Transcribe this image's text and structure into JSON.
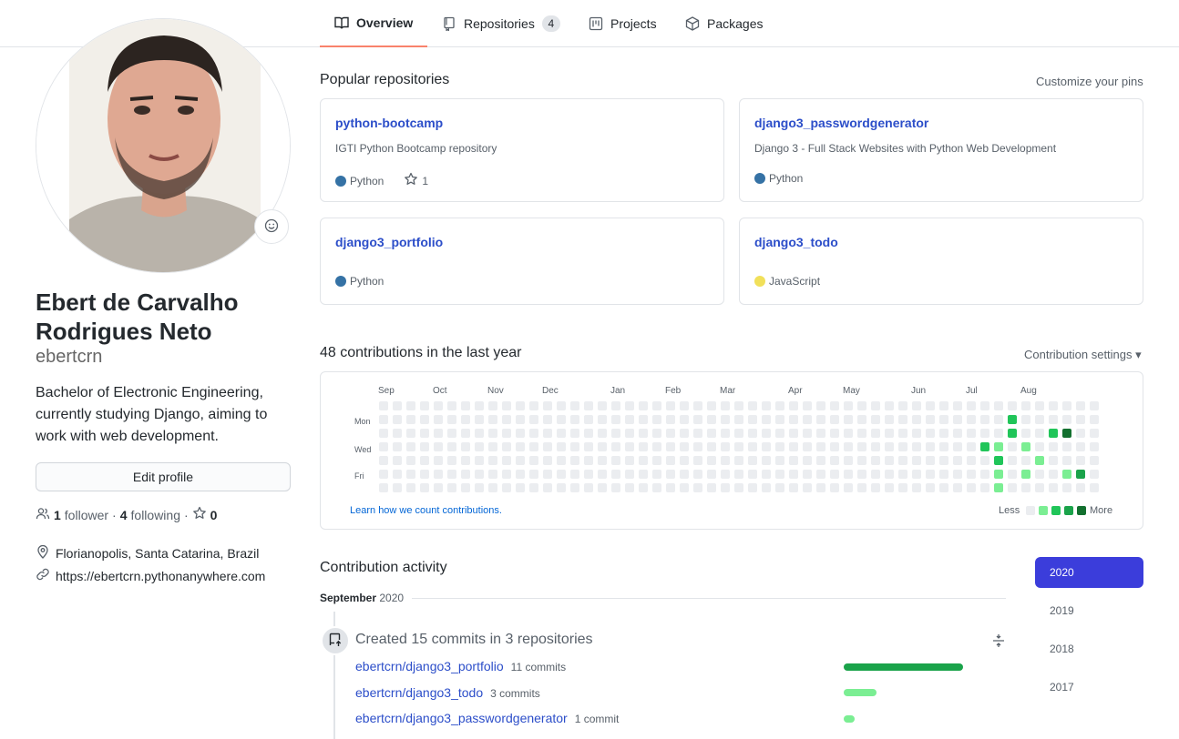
{
  "tabs": [
    {
      "label": "Overview",
      "icon": "book-icon",
      "active": true
    },
    {
      "label": "Repositories",
      "icon": "repo-icon",
      "count": "4"
    },
    {
      "label": "Projects",
      "icon": "project-icon"
    },
    {
      "label": "Packages",
      "icon": "package-icon"
    }
  ],
  "profile": {
    "fullname": "Ebert de Carvalho Rodrigues Neto",
    "username": "ebertcrn",
    "bio": "Bachelor of Electronic Engineering, currently studying Django, aiming to work with web development.",
    "edit_label": "Edit profile",
    "followers_count": "1",
    "followers_label": "follower",
    "following_count": "4",
    "following_label": "following",
    "stars_count": "0",
    "location": "Florianopolis, Santa Catarina, Brazil",
    "website": "https://ebertcrn.pythonanywhere.com"
  },
  "popular": {
    "title": "Popular repositories",
    "customize": "Customize your pins",
    "repos": [
      {
        "name": "python-bootcamp",
        "desc": "IGTI Python Bootcamp repository",
        "lang": "Python",
        "lang_color": "#3572A5",
        "stars": "1"
      },
      {
        "name": "django3_passwordgenerator",
        "desc": "Django 3 - Full Stack Websites with Python Web Development",
        "lang": "Python",
        "lang_color": "#3572A5"
      },
      {
        "name": "django3_portfolio",
        "desc": "",
        "lang": "Python",
        "lang_color": "#3572A5"
      },
      {
        "name": "django3_todo",
        "desc": "",
        "lang": "JavaScript",
        "lang_color": "#f1e05a"
      }
    ]
  },
  "contributions": {
    "title": "48 contributions in the last year",
    "settings": "Contribution settings",
    "months": [
      "Sep",
      "Oct",
      "Nov",
      "Dec",
      "Jan",
      "Feb",
      "Mar",
      "Apr",
      "May",
      "Jun",
      "Jul",
      "Aug"
    ],
    "weekdays": [
      "Mon",
      "Wed",
      "Fri"
    ],
    "learn": "Learn how we count contributions.",
    "less": "Less",
    "more": "More",
    "colors": [
      "#ebedf0",
      "#9be9a8",
      "#40c463",
      "#30a14e",
      "#216e39"
    ],
    "legend_colors": [
      "#ebedf0",
      "#7bee93",
      "#20c559",
      "#1aa34a",
      "#13702f"
    ]
  },
  "activity": {
    "title": "Contribution activity",
    "month": "September",
    "year": "2020",
    "event": "Created 15 commits in 3 repositories",
    "commits": [
      {
        "repo": "ebertcrn/django3_portfolio",
        "count": "11 commits",
        "n": 11
      },
      {
        "repo": "ebertcrn/django3_todo",
        "count": "3 commits",
        "n": 3
      },
      {
        "repo": "ebertcrn/django3_passwordgenerator",
        "count": "1 commit",
        "n": 1
      }
    ]
  },
  "years": [
    "2020",
    "2019",
    "2018",
    "2017"
  ]
}
